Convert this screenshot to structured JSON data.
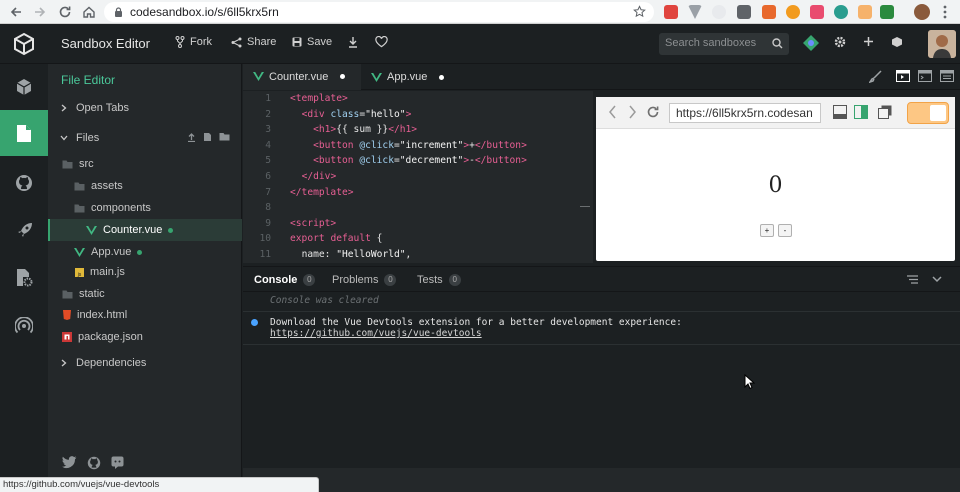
{
  "browser": {
    "url": "codesandbox.io/s/6ll5krx5rn",
    "status_link": "https://github.com/vuejs/vue-devtools"
  },
  "header": {
    "title": "Sandbox Editor",
    "fork_label": "Fork",
    "share_label": "Share",
    "save_label": "Save",
    "search_placeholder": "Search sandboxes"
  },
  "sidebar": {
    "title": "File Editor",
    "open_tabs": "Open Tabs",
    "files": "Files",
    "tree": [
      {
        "label": "src",
        "type": "folder"
      },
      {
        "label": "assets",
        "type": "folder"
      },
      {
        "label": "components",
        "type": "folder"
      },
      {
        "label": "Counter.vue",
        "type": "vue",
        "modified": true,
        "selected": true
      },
      {
        "label": "App.vue",
        "type": "vue",
        "modified": true
      },
      {
        "label": "main.js",
        "type": "js"
      },
      {
        "label": "static",
        "type": "folder"
      },
      {
        "label": "index.html",
        "type": "html"
      },
      {
        "label": "package.json",
        "type": "json"
      }
    ],
    "dependencies": "Dependencies"
  },
  "editor": {
    "tabs": [
      {
        "label": "Counter.vue",
        "modified": true,
        "active": true
      },
      {
        "label": "App.vue",
        "modified": true,
        "active": false
      }
    ],
    "line_numbers": [
      "1",
      "2",
      "3",
      "4",
      "5",
      "6",
      "7",
      "8",
      "9",
      "10",
      "11"
    ]
  },
  "preview": {
    "url": "https://6ll5krx5rn.codesan",
    "sum_value": "0",
    "increment_label": "+",
    "decrement_label": "-"
  },
  "console": {
    "tabs": [
      {
        "label": "Console",
        "count": "0"
      },
      {
        "label": "Problems",
        "count": "0"
      },
      {
        "label": "Tests",
        "count": "0"
      }
    ],
    "cleared": "Console was cleared",
    "message": "Download the Vue Devtools extension for a better development experience:",
    "link": "https://github.com/vuejs/vue-devtools"
  },
  "colors": {
    "accent": "#37a46f",
    "tag": "#e65f93",
    "attr": "#a0d0f0"
  },
  "icons": [
    "back-icon",
    "forward-icon",
    "reload-icon",
    "home-icon",
    "lock-icon",
    "star-icon",
    "codesandbox-logo",
    "fork-icon",
    "share-icon",
    "save-icon",
    "download-icon",
    "heart-icon",
    "search-icon",
    "gear-icon",
    "plus-icon",
    "cube-icon"
  ]
}
